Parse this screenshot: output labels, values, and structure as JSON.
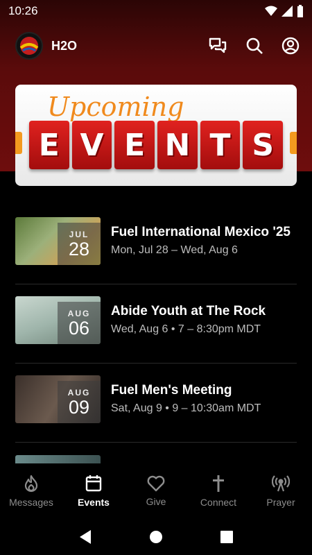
{
  "status_bar": {
    "time": "10:26"
  },
  "app": {
    "title": "H2O"
  },
  "banner": {
    "script": "Upcoming",
    "word": [
      "E",
      "V",
      "E",
      "N",
      "T",
      "S"
    ]
  },
  "events": [
    {
      "month": "JUL",
      "day": "28",
      "title": "Fuel International Mexico '25",
      "subtitle": "Mon, Jul 28 – Wed, Aug 6"
    },
    {
      "month": "AUG",
      "day": "06",
      "title": "Abide Youth at The Rock",
      "subtitle": "Wed, Aug 6 • 7 – 8:30pm MDT"
    },
    {
      "month": "AUG",
      "day": "09",
      "title": "Fuel Men's Meeting",
      "subtitle": "Sat, Aug 9 • 9 – 10:30am MDT"
    }
  ],
  "nav": {
    "messages": "Messages",
    "events": "Events",
    "give": "Give",
    "connect": "Connect",
    "prayer": "Prayer"
  },
  "icons": {
    "chat": "chat-icon",
    "search": "search-icon",
    "account": "account-icon"
  },
  "colors": {
    "header": "#6e0d0d",
    "active_nav": "#ffffff",
    "inactive_nav": "#8d8d8d"
  }
}
